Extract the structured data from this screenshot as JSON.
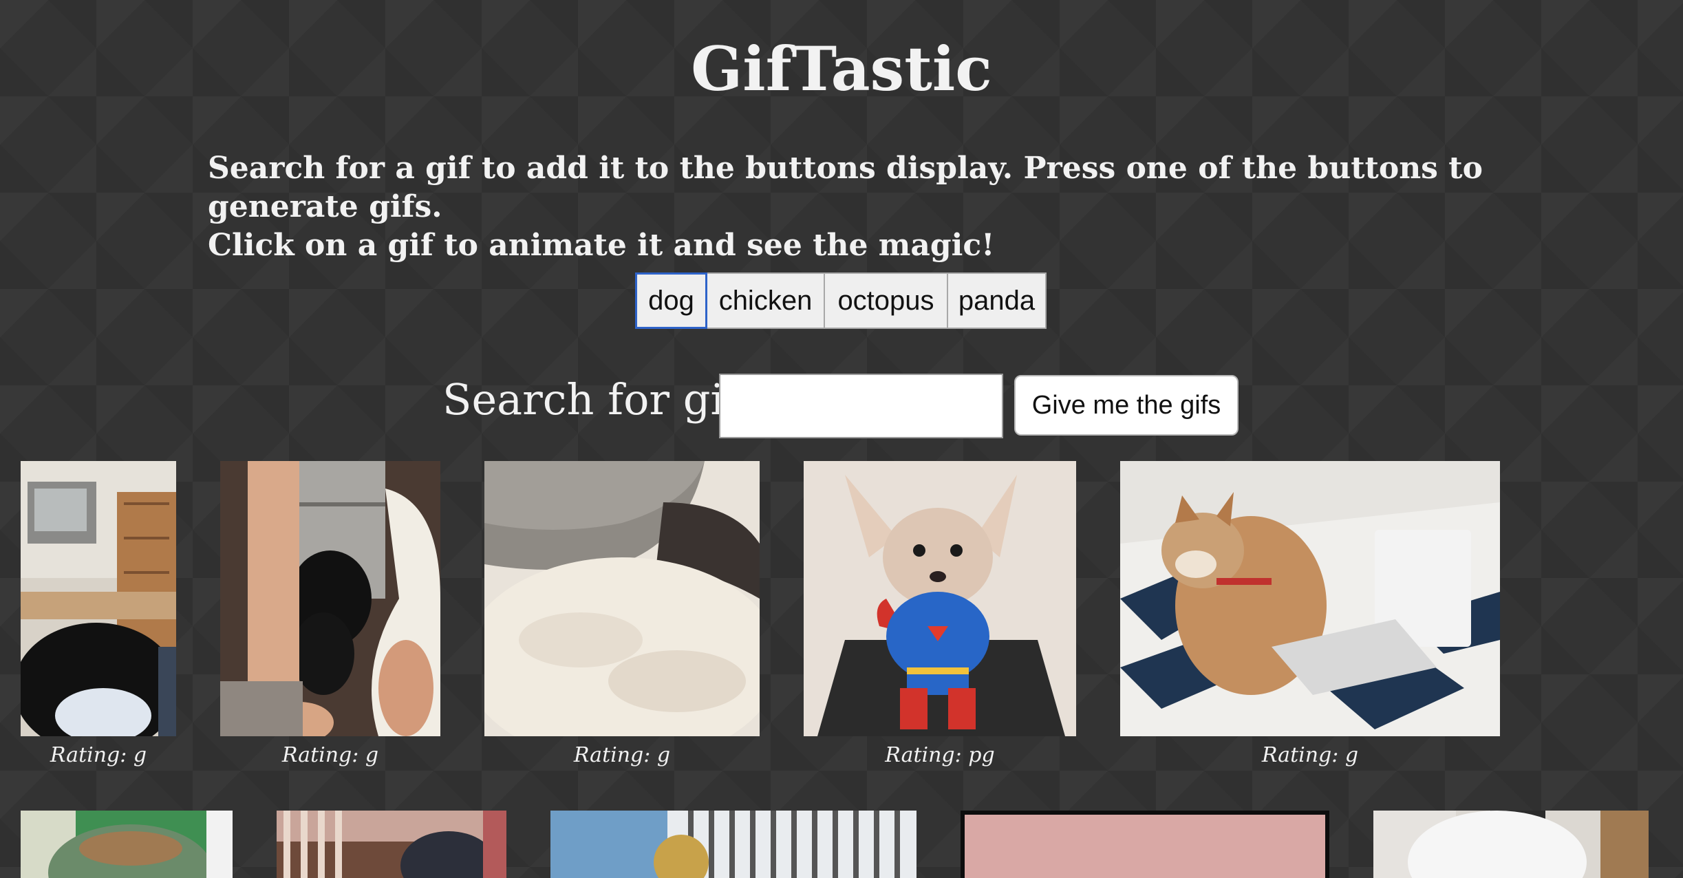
{
  "app": {
    "title": "GifTastic",
    "instructions_line1": "Search for a gif to add it to the buttons display. Press one of the buttons to generate gifs.",
    "instructions_line2": "Click on a gif to animate it and see the magic!"
  },
  "topics": [
    {
      "label": "dog",
      "active": true
    },
    {
      "label": "chicken"
    },
    {
      "label": "octopus"
    },
    {
      "label": "panda"
    }
  ],
  "search": {
    "label": "Search for gifs",
    "value": "",
    "placeholder": "",
    "submit_label": "Give me the gifs"
  },
  "gifs_row1": [
    {
      "subject": "black puppy in living room",
      "rating": "Rating: g"
    },
    {
      "subject": "black dog at door with person",
      "rating": "Rating: g"
    },
    {
      "subject": "fluffy white dog on knit blanket",
      "rating": "Rating: g"
    },
    {
      "subject": "chihuahua in superman costume on treadmill",
      "rating": "Rating: pg"
    },
    {
      "subject": "shiba inu typing on laptop in bed",
      "rating": "Rating: g"
    }
  ],
  "gifs_row2": [
    {
      "subject": "dog wearing green knit hat"
    },
    {
      "subject": "dog near wooden railing"
    },
    {
      "subject": "dog toy by window blinds"
    },
    {
      "subject": "dog on pink background"
    },
    {
      "subject": "white fluffy dog"
    }
  ],
  "colors": {
    "background": "#333333",
    "text": "#f2f2f2",
    "active_button_border": "#2e63c9"
  }
}
